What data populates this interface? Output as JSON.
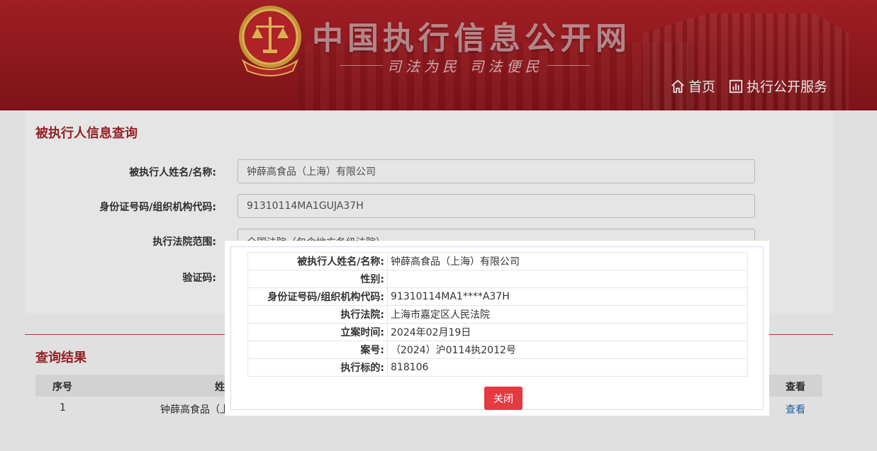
{
  "header": {
    "site_title": "中国执行信息公开网",
    "slogan": "司法为民  司法便民",
    "nav": [
      {
        "label": "首页",
        "icon": "home-icon"
      },
      {
        "label": "执行公开服务",
        "icon": "chart-icon"
      }
    ]
  },
  "query_panel": {
    "title": "被执行人信息查询",
    "fields": [
      {
        "label": "被执行人姓名/名称:",
        "value": "钟薛高食品（上海）有限公司"
      },
      {
        "label": "身份证号码/组织机构代码:",
        "value": "91310114MA1GUJA37H"
      },
      {
        "label": "执行法院范围:",
        "value": "全国法院（包含地方各级法院）"
      },
      {
        "label": "验证码:",
        "value": ""
      }
    ]
  },
  "results": {
    "title": "查询结果",
    "columns": [
      "序号",
      "姓",
      "查看"
    ],
    "rows": [
      {
        "index": "1",
        "name": "钟薛高食品（上",
        "action": "查看"
      }
    ]
  },
  "modal": {
    "rows": [
      {
        "key": "被执行人姓名/名称:",
        "value": "钟薛高食品（上海）有限公司"
      },
      {
        "key": "性别:",
        "value": ""
      },
      {
        "key": "身份证号码/组织机构代码:",
        "value": "91310114MA1****A37H"
      },
      {
        "key": "执行法院:",
        "value": "上海市嘉定区人民法院"
      },
      {
        "key": "立案时间:",
        "value": "2024年02月19日"
      },
      {
        "key": "案号:",
        "value": "（2024）沪0114执2012号"
      },
      {
        "key": "执行标的:",
        "value": "818106"
      }
    ],
    "close_label": "关闭"
  },
  "colors": {
    "brand_red": "#a5262c",
    "close_button": "#e53a40",
    "link_blue": "#2267b5"
  }
}
